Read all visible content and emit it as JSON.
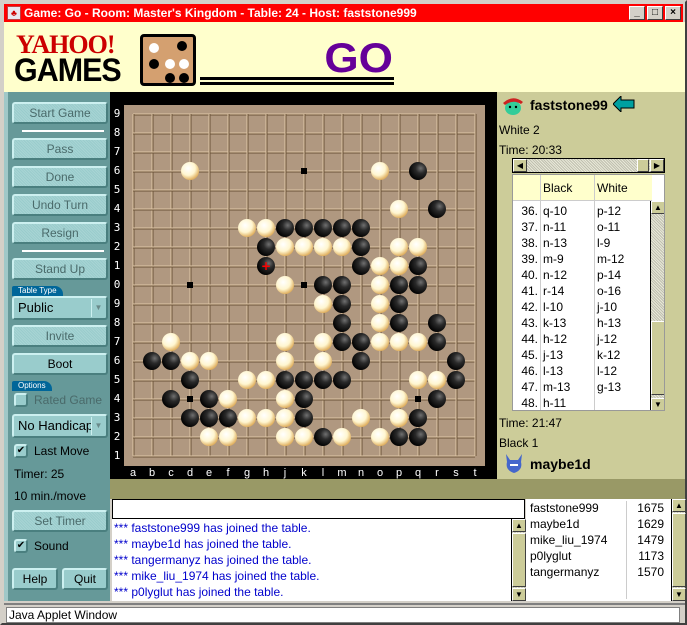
{
  "window": {
    "title": "Game: Go - Room: Master's Kingdom - Table: 24 - Host: faststone999",
    "controls": [
      "minimize",
      "maximize",
      "close"
    ]
  },
  "header": {
    "brand_top": "YAHOO!",
    "brand_bottom": "GAMES",
    "game_title": "GO"
  },
  "sidebar": {
    "start_game": "Start Game",
    "pass": "Pass",
    "done": "Done",
    "undo_turn": "Undo Turn",
    "resign": "Resign",
    "stand_up": "Stand Up",
    "table_type_label": "Table Type",
    "table_type_value": "Public",
    "invite": "Invite",
    "boot": "Boot",
    "options_label": "Options",
    "rated_game": "Rated Game",
    "rated_game_checked": false,
    "handicap_value": "No Handicap",
    "last_move": "Last Move",
    "last_move_checked": true,
    "timer": "Timer: 25",
    "time_per_move": "10 min./move",
    "set_timer": "Set Timer",
    "sound": "Sound",
    "sound_checked": true,
    "help": "Help",
    "quit": "Quit"
  },
  "board": {
    "size": 19,
    "col_labels": [
      "a",
      "b",
      "c",
      "d",
      "e",
      "f",
      "g",
      "h",
      "j",
      "k",
      "l",
      "m",
      "n",
      "o",
      "p",
      "q",
      "r",
      "s",
      "t"
    ],
    "row_labels": [
      "9",
      "8",
      "7",
      "6",
      "5",
      "4",
      "3",
      "2",
      "1",
      "0",
      "9",
      "8",
      "7",
      "6",
      "5",
      "4",
      "3",
      "2",
      "1"
    ],
    "hoshi": [
      "d16",
      "k16",
      "q16",
      "d10",
      "k10",
      "q10",
      "d4",
      "k4",
      "q4"
    ],
    "last_move": "h11",
    "colors": {
      "board": "#b09880",
      "line": "#e0c8a8",
      "frame": "#000000",
      "last_move_marker": "#ff0000"
    },
    "black": [
      "q16",
      "r14",
      "j13",
      "k13",
      "l13",
      "m13",
      "n13",
      "h12",
      "n12",
      "h11",
      "n11",
      "q11",
      "l10",
      "m10",
      "p10",
      "q10",
      "m9",
      "p9",
      "m8",
      "p8",
      "r8",
      "m7",
      "n7",
      "r7",
      "b6",
      "c6",
      "n6",
      "s6",
      "d5",
      "j5",
      "k5",
      "l5",
      "m5",
      "s5",
      "c4",
      "e4",
      "k4",
      "r4",
      "d3",
      "e3",
      "f3",
      "k3",
      "q3",
      "l2",
      "p2",
      "q2"
    ],
    "white": [
      "d16",
      "o16",
      "p14",
      "g13",
      "h13",
      "j12",
      "k12",
      "l12",
      "m12",
      "p12",
      "q12",
      "o11",
      "p11",
      "j10",
      "o10",
      "l9",
      "o9",
      "o8",
      "c7",
      "j7",
      "l7",
      "o7",
      "p7",
      "q7",
      "d6",
      "e6",
      "j6",
      "l6",
      "g5",
      "h5",
      "q5",
      "r5",
      "f4",
      "j4",
      "p4",
      "g3",
      "h3",
      "j3",
      "n3",
      "p3",
      "e2",
      "f2",
      "j2",
      "k2",
      "m2",
      "o2"
    ]
  },
  "players": {
    "white": {
      "name": "faststone99",
      "captures": "White 2",
      "time": "Time: 20:33",
      "to_move": true
    },
    "black": {
      "name": "maybe1d",
      "captures": "Black 1",
      "time": "Time: 21:47"
    }
  },
  "move_list": {
    "headers": [
      "",
      "Black",
      "White"
    ],
    "rows": [
      {
        "n": "36.",
        "b": "q-10",
        "w": "p-12"
      },
      {
        "n": "37.",
        "b": "n-11",
        "w": "o-11"
      },
      {
        "n": "38.",
        "b": "n-13",
        "w": "l-9"
      },
      {
        "n": "39.",
        "b": "m-9",
        "w": "m-12"
      },
      {
        "n": "40.",
        "b": "n-12",
        "w": "p-14"
      },
      {
        "n": "41.",
        "b": "r-14",
        "w": "o-16"
      },
      {
        "n": "42.",
        "b": "l-10",
        "w": "j-10"
      },
      {
        "n": "43.",
        "b": "k-13",
        "w": "h-13"
      },
      {
        "n": "44.",
        "b": "h-12",
        "w": "j-12"
      },
      {
        "n": "45.",
        "b": "j-13",
        "w": "k-12"
      },
      {
        "n": "46.",
        "b": "l-13",
        "w": "l-12"
      },
      {
        "n": "47.",
        "b": "m-13",
        "w": "g-13"
      },
      {
        "n": "48.",
        "b": "h-11",
        "w": ""
      }
    ]
  },
  "chat": {
    "input_value": "",
    "messages": [
      "*** faststone999 has joined the table.",
      "*** maybe1d has joined the table.",
      "*** tangermanyz has joined the table.",
      "*** mike_liu_1974 has joined the table.",
      "*** p0lyglut has joined the table."
    ]
  },
  "users": [
    {
      "name": "faststone999",
      "rating": "1675"
    },
    {
      "name": "maybe1d",
      "rating": "1629"
    },
    {
      "name": "mike_liu_1974",
      "rating": "1479"
    },
    {
      "name": "p0lyglut",
      "rating": "1173"
    },
    {
      "name": "tangermanyz",
      "rating": "1570"
    }
  ],
  "status_bar": "Java Applet Window"
}
